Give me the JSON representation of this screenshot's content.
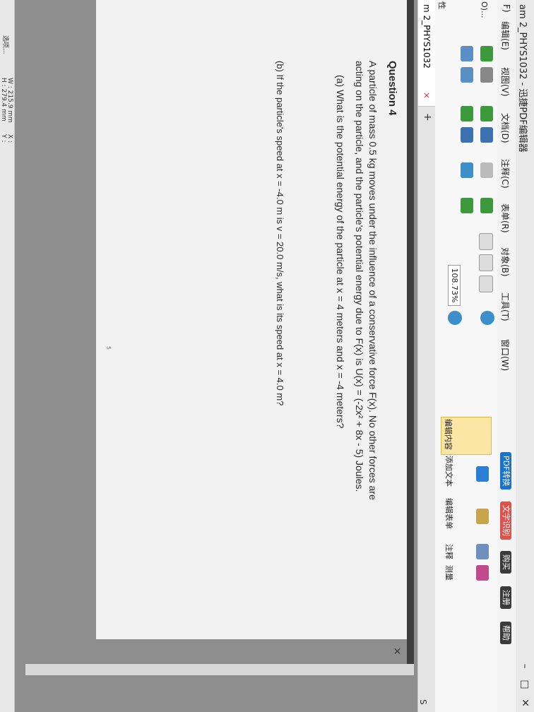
{
  "window": {
    "title": "am 2_PHYS1032 - 迅捷PDF编辑器",
    "min": "–",
    "max": "□",
    "close": "✕"
  },
  "menu": {
    "items": [
      "F)",
      "编辑(E)",
      "视图(V)",
      "文档(D)",
      "注释(C)",
      "表单(R)",
      "对象(B)",
      "工具(T)",
      "窗口(W)"
    ]
  },
  "menu_right": {
    "convert": "PDF转换",
    "ocr": "文字识别",
    "buy": "购买",
    "register": "注册",
    "help": "帮助"
  },
  "ribbon": {
    "zoom": "108.73%",
    "edit": "编辑内容",
    "add_text": "添加文本",
    "edit_form": "编辑表单",
    "comment": "注释",
    "measure": "测量",
    "left_label": "O)...",
    "left_label2": "性"
  },
  "tab": {
    "label": "m 2_PHYS1032",
    "close": "×",
    "add": "+"
  },
  "doc": {
    "question_title": "Question 4",
    "line1": "A particle of mass 0.5 kg moves under the influence of a conservative force F(x). No other forces are",
    "line2": "acting on the particle, and the particle's potential energy due to F(x) is U(x) = (-2x² + 8x - 5) Joules.",
    "part_a": "(a)  What is the potential energy of the particle at x = 4 meters and x = -4 meters?",
    "part_b": "(b)  If the particle's speed at x = -4.0 m is v = 20.0 m/s, what is its speed at x = 4.0 m?",
    "page_number": "5",
    "close": "×",
    "side_s": "S"
  },
  "status": {
    "left": "选项...",
    "width": "W : 215.9 mm",
    "height": "H : 279.4 mm",
    "x": "X :",
    "y": "Y :"
  },
  "colors": {
    "accent": "#1a73c9",
    "edit_highlight": "#fbe6a6"
  }
}
